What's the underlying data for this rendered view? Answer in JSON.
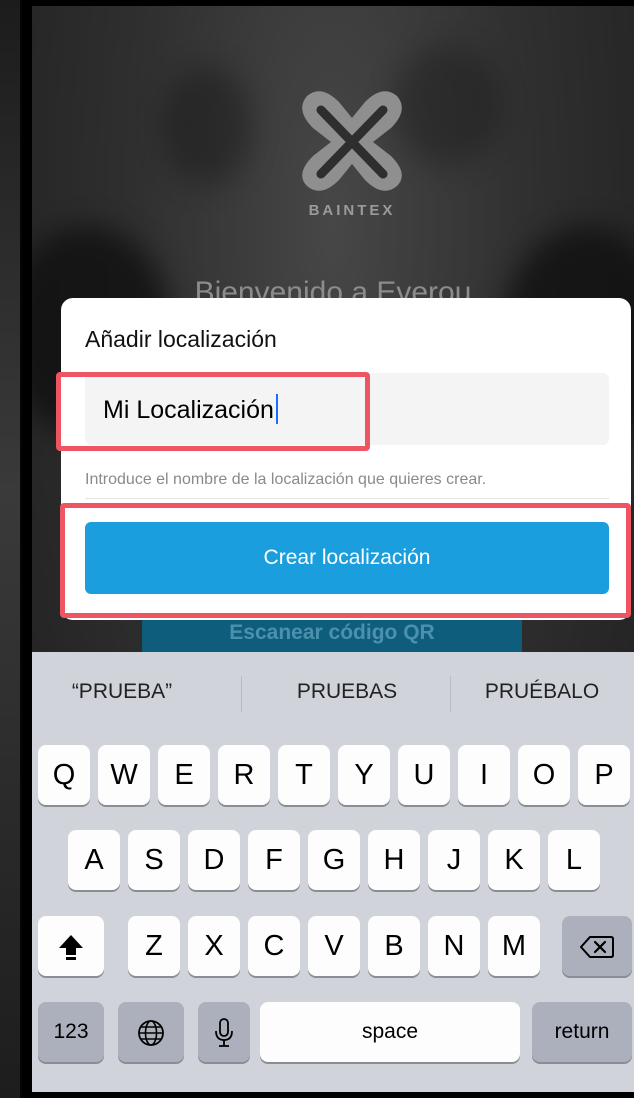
{
  "app": {
    "logo_text": "BAINTEX",
    "welcome": "Bienvenido a Everou",
    "scan_button": "Escanear código QR"
  },
  "dialog": {
    "title": "Añadir localización",
    "input_value": "Mi Localización",
    "helper": "Introduce el nombre de la localización que quieres crear.",
    "primary_button": "Crear localización"
  },
  "keyboard": {
    "suggestions": [
      "“PRUEBA”",
      "PRUEBAS",
      "PRUÉBALO"
    ],
    "row1": [
      "Q",
      "W",
      "E",
      "R",
      "T",
      "Y",
      "U",
      "I",
      "O",
      "P"
    ],
    "row2": [
      "A",
      "S",
      "D",
      "F",
      "G",
      "H",
      "J",
      "K",
      "L"
    ],
    "row3": [
      "Z",
      "X",
      "C",
      "V",
      "B",
      "N",
      "M"
    ],
    "numbers_key": "123",
    "space_key": "space",
    "return_key": "return",
    "icons": {
      "shift": "shift-icon",
      "delete": "backspace-icon",
      "globe": "globe-icon",
      "mic": "microphone-icon"
    }
  },
  "colors": {
    "primary": "#1a9ede",
    "highlight": "#ee5562",
    "keyboard_bg": "#d0d3da"
  }
}
